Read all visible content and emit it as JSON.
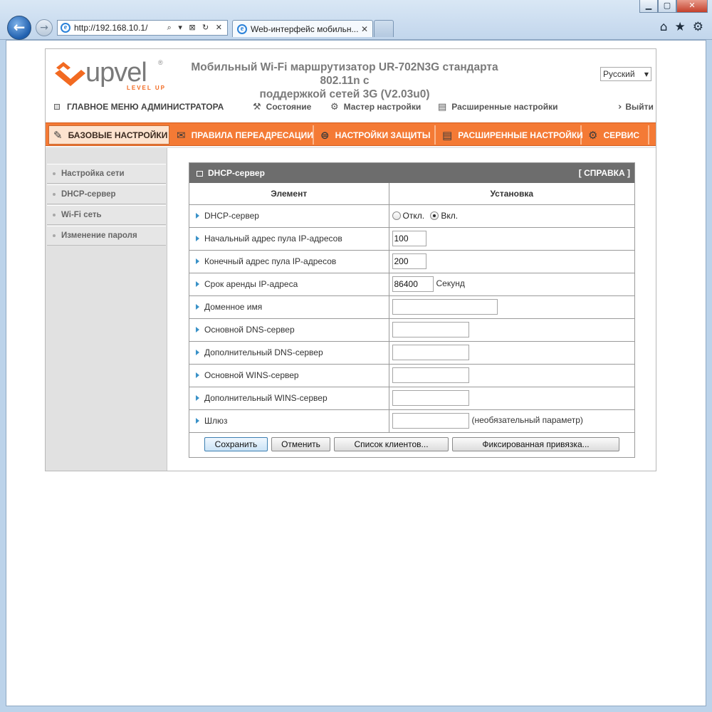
{
  "browser": {
    "window_buttons": {
      "minimize": "▁",
      "maximize": "▢",
      "close": "✕"
    },
    "back_glyph": "←",
    "forward_glyph": "→",
    "address": "http://192.168.10.1/",
    "address_tools": "⌕ ▾ ⊠ ↻ ✕",
    "tab_title": "Web-интерфейс мобильн...",
    "tab_close": "✕",
    "toolbar_icons": {
      "home": "⌂",
      "favorites": "★",
      "tools": "⚙"
    }
  },
  "header": {
    "logo_text": "upvel",
    "logo_tagline": "LEVEL UP",
    "logo_registered": "®",
    "title_line1": "Мобильный Wi-Fi маршрутизатор UR-702N3G стандарта 802.11n с",
    "title_line2": "поддержкой сетей 3G  (V2.03u0)",
    "language": "Русский",
    "language_arrow": "▼"
  },
  "topnav": {
    "admin_menu": "ГЛАВНОЕ МЕНЮ АДМИНИСТРАТОРА",
    "status": "Состояние",
    "wizard": "Мастер настройки",
    "advanced": "Расширенные настройки",
    "logout": "Выйти",
    "status_icon": "⚒",
    "wizard_icon": "⚙",
    "advanced_icon": "▤",
    "logout_icon": "›"
  },
  "main_tabs": [
    {
      "label": "БАЗОВЫЕ НАСТРОЙКИ",
      "icon": "✎",
      "active": true
    },
    {
      "label": "ПРАВИЛА ПЕРЕАДРЕСАЦИИ",
      "icon": "✉",
      "active": false
    },
    {
      "label": "НАСТРОЙКИ ЗАЩИТЫ",
      "icon": "⊜",
      "active": false
    },
    {
      "label": "РАСШИРЕННЫЕ НАСТРОЙКИ",
      "icon": "▤",
      "active": false
    },
    {
      "label": "СЕРВИС",
      "icon": "⚙",
      "active": false
    }
  ],
  "sidebar": {
    "items": [
      {
        "label": "Настройка сети"
      },
      {
        "label": "DHCP-сервер"
      },
      {
        "label": "Wi-Fi сеть"
      },
      {
        "label": "Изменение пароля"
      }
    ]
  },
  "panel": {
    "title": "DHCP-сервер",
    "help": "[ СПРАВКА ]",
    "col_element": "Элемент",
    "col_setting": "Установка",
    "rows": {
      "dhcp": {
        "label": "DHCP-сервер",
        "off": "Откл.",
        "on": "Вкл.",
        "selected": "on"
      },
      "pool_start": {
        "label": "Начальный адрес пула IP-адресов",
        "value": "100"
      },
      "pool_end": {
        "label": "Конечный адрес пула IP-адресов",
        "value": "200"
      },
      "lease": {
        "label": "Срок аренды IP-адреса",
        "value": "86400",
        "unit": "Секунд"
      },
      "domain": {
        "label": "Доменное имя",
        "value": ""
      },
      "dns1": {
        "label": "Основной DNS-сервер",
        "value": ""
      },
      "dns2": {
        "label": "Дополнительный DNS-сервер",
        "value": ""
      },
      "wins1": {
        "label": "Основной WINS-сервер",
        "value": ""
      },
      "wins2": {
        "label": "Дополнительный WINS-сервер",
        "value": ""
      },
      "gateway": {
        "label": "Шлюз",
        "value": "",
        "note": "(необязательный параметр)"
      }
    },
    "buttons": {
      "save": "Сохранить",
      "cancel": "Отменить",
      "clients": "Список клиентов...",
      "binding": "Фиксированная привязка..."
    }
  },
  "colors": {
    "accent_orange": "#f47a35",
    "panel_header": "#6d6d6d",
    "sidebar_bg": "#e1e1e1",
    "arrow_blue": "#3a92c8"
  }
}
